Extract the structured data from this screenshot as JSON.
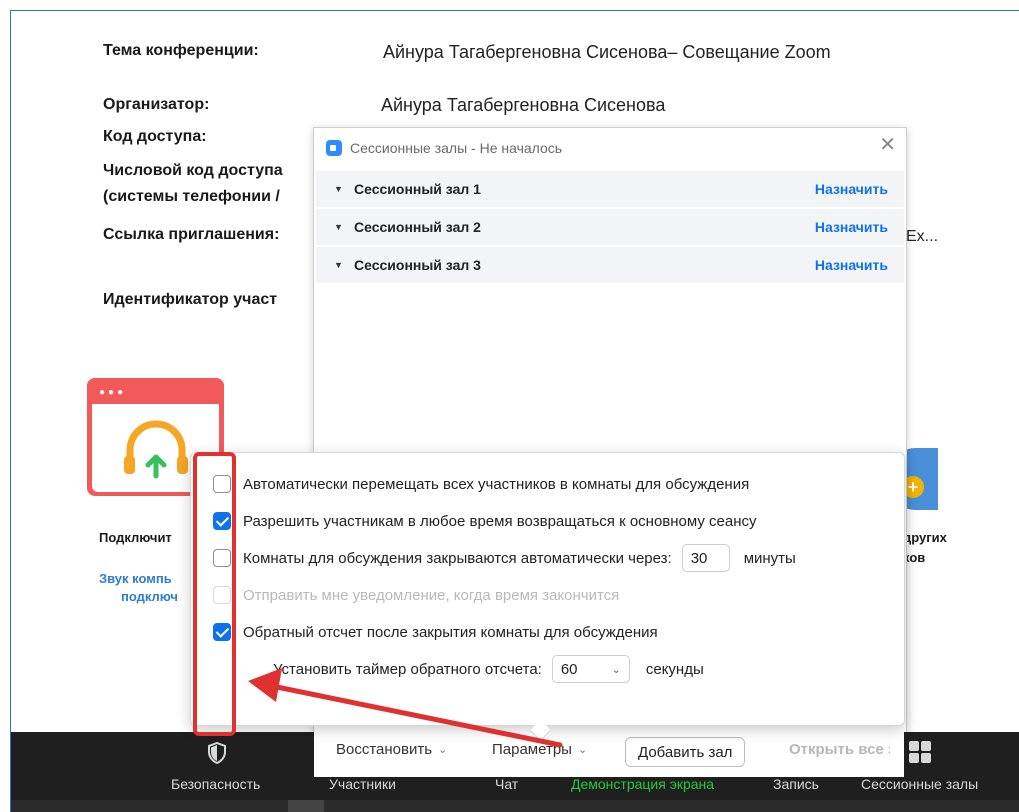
{
  "info": {
    "topic_label": "Тема конференции:",
    "topic_value": "Айнура Тагабергеновна Сисенова– Совещание Zoom",
    "host_label": "Организатор:",
    "host_value": "Айнура Тагабергеновна Сисенова",
    "passcode_label": "Код доступа:",
    "numeric_label_1": "Числовой код доступа",
    "numeric_label_2": "(системы телефонии /",
    "invite_label": "Ссылка приглашения:",
    "invite_value_fragment": "Ex...",
    "participant_id_label": "Идентификатор участ"
  },
  "join_tile": {
    "label": "Подключит",
    "link_line1": "Звук компь",
    "link_line2": "подключ"
  },
  "right_tile": {
    "label_line1": "других",
    "label_line2": "ков"
  },
  "dialog": {
    "title": "Сессионные залы - Не началось",
    "rooms": [
      {
        "name": "Сессионный зал 1",
        "action": "Назначить"
      },
      {
        "name": "Сессионный зал 2",
        "action": "Назначить"
      },
      {
        "name": "Сессионный зал 3",
        "action": "Назначить"
      }
    ],
    "footer": {
      "restore": "Восстановить",
      "options": "Параметры",
      "add_room": "Добавить зал",
      "open_all": "Открыть все з"
    }
  },
  "options": {
    "auto_move": {
      "label": "Автоматически перемещать всех участников в комнаты для обсуждения",
      "checked": false
    },
    "allow_return": {
      "label": "Разрешить участникам в любое время возвращаться к основному сеансу",
      "checked": true
    },
    "auto_close": {
      "label": "Комнаты для обсуждения закрываются автоматически через:",
      "value": "30",
      "unit": "минуты",
      "checked": false
    },
    "notify": {
      "label": "Отправить мне уведомление, когда время закончится",
      "checked": false,
      "disabled": true
    },
    "countdown": {
      "label": "Обратный отсчет после закрытия комнаты для обсуждения",
      "checked": true
    },
    "timer": {
      "label": "Установить таймер обратного отсчета:",
      "value": "60",
      "unit": "секунды"
    }
  },
  "toolbar": {
    "security": "Безопасность",
    "participants": "Участники",
    "chat": "Чат",
    "share": "Демонстрация экрана",
    "record": "Запись",
    "breakout": "Сессионные залы"
  },
  "colors": {
    "accent": "#0e72ed",
    "annotation": "#e03131",
    "share_green": "#27c93f",
    "toolbar_bg": "#1f1f1f"
  }
}
